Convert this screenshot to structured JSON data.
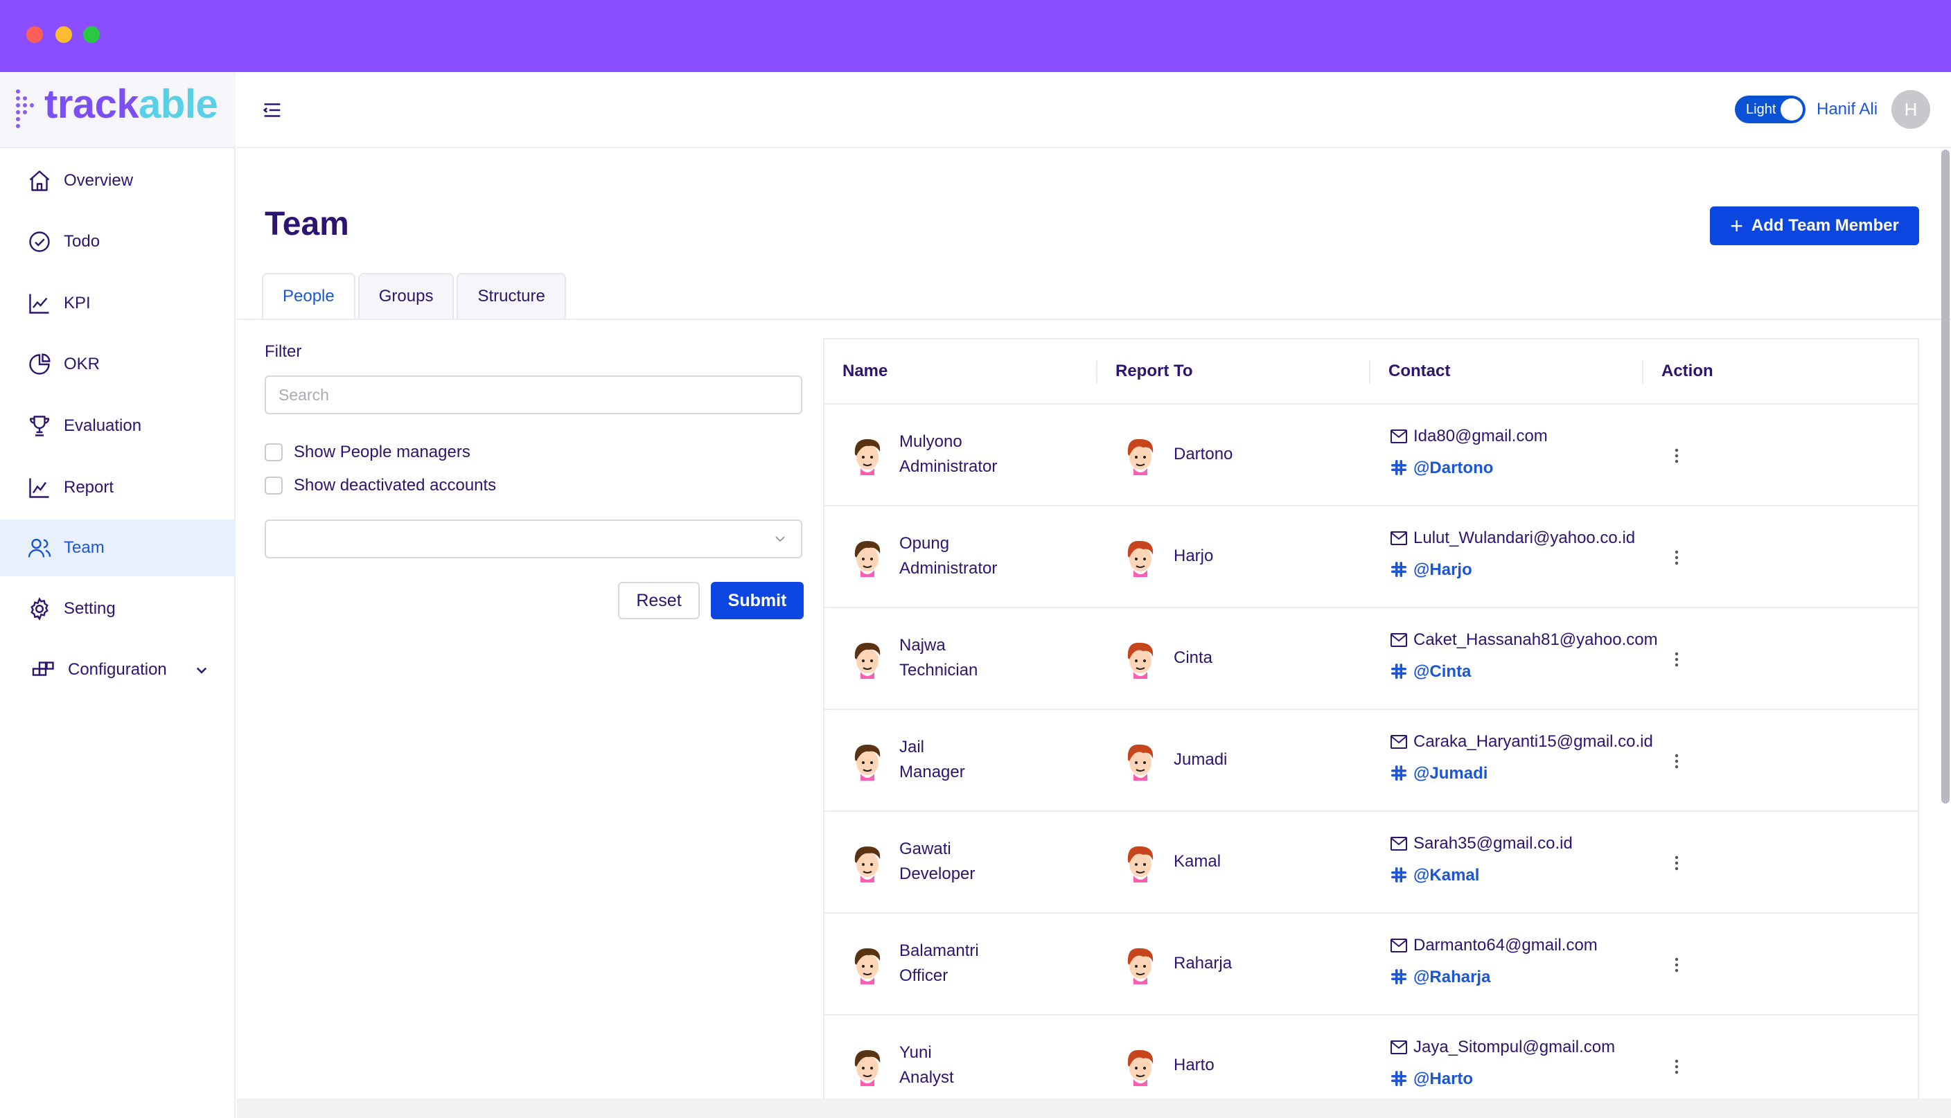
{
  "app": {
    "logo_part1": "track",
    "logo_part2": "able",
    "brand_color": "#8a4dff",
    "primary_color": "#0b46e0"
  },
  "sidebar": {
    "items": [
      {
        "label": "Overview",
        "icon": "home-icon"
      },
      {
        "label": "Todo",
        "icon": "check-circle-icon"
      },
      {
        "label": "KPI",
        "icon": "line-chart-icon"
      },
      {
        "label": "OKR",
        "icon": "pie-chart-icon"
      },
      {
        "label": "Evaluation",
        "icon": "trophy-icon"
      },
      {
        "label": "Report",
        "icon": "report-chart-icon"
      },
      {
        "label": "Team",
        "icon": "team-icon",
        "active": true
      },
      {
        "label": "Setting",
        "icon": "gear-icon"
      },
      {
        "label": "Configuration",
        "icon": "blocks-icon",
        "expandable": true
      }
    ]
  },
  "header": {
    "theme_label": "Light",
    "user_name": "Hanif Ali",
    "avatar_initial": "H"
  },
  "page": {
    "title": "Team",
    "add_button": "Add Team Member",
    "tabs": [
      {
        "label": "People",
        "active": true
      },
      {
        "label": "Groups"
      },
      {
        "label": "Structure"
      }
    ]
  },
  "filter": {
    "label": "Filter",
    "search_placeholder": "Search",
    "search_value": "",
    "checkbox_managers": "Show People managers",
    "checkbox_deactivated": "Show deactivated accounts",
    "select_value": "",
    "reset_label": "Reset",
    "submit_label": "Submit"
  },
  "table": {
    "headers": {
      "name": "Name",
      "report_to": "Report To",
      "contact": "Contact",
      "action": "Action"
    },
    "rows": [
      {
        "name": "Mulyono",
        "role": "Administrator",
        "report_to": "Dartono",
        "email": "Ida80@gmail.com",
        "handle": "@Dartono"
      },
      {
        "name": "Opung",
        "role": "Administrator",
        "report_to": "Harjo",
        "email": "Lulut_Wulandari@yahoo.co.id",
        "handle": "@Harjo"
      },
      {
        "name": "Najwa",
        "role": "Technician",
        "report_to": "Cinta",
        "email": "Caket_Hassanah81@yahoo.com",
        "handle": "@Cinta"
      },
      {
        "name": "Jail",
        "role": "Manager",
        "report_to": "Jumadi",
        "email": "Caraka_Haryanti15@gmail.co.id",
        "handle": "@Jumadi"
      },
      {
        "name": "Gawati",
        "role": "Developer",
        "report_to": "Kamal",
        "email": "Sarah35@gmail.co.id",
        "handle": "@Kamal"
      },
      {
        "name": "Balamantri",
        "role": "Officer",
        "report_to": "Raharja",
        "email": "Darmanto64@gmail.com",
        "handle": "@Raharja"
      },
      {
        "name": "Yuni",
        "role": "Analyst",
        "report_to": "Harto",
        "email": "Jaya_Sitompul@gmail.com",
        "handle": "@Harto"
      }
    ]
  }
}
